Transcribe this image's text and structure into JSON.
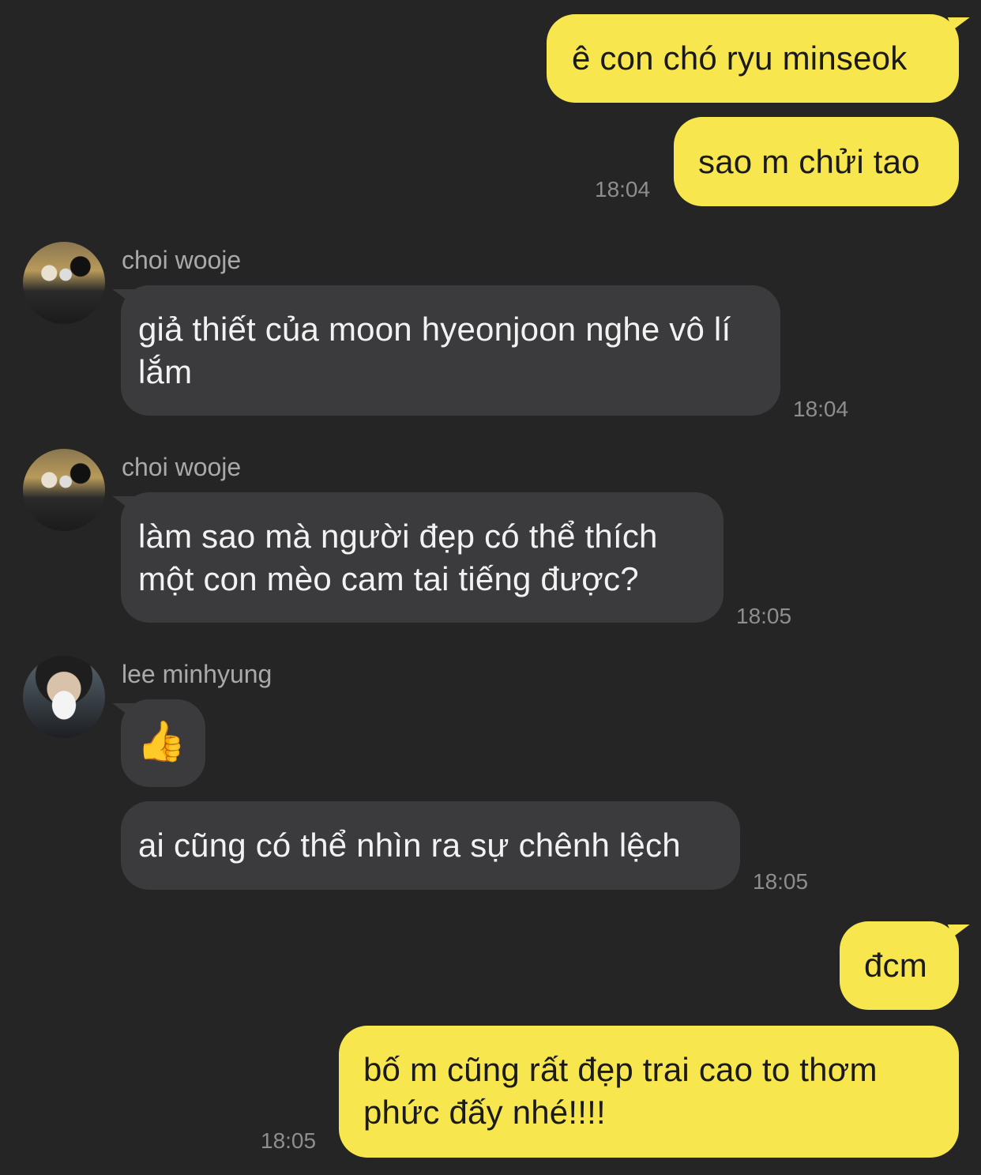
{
  "messages": [
    {
      "text": "ê con chó ryu minseok"
    },
    {
      "text": "sao m chửi tao",
      "time": "18:04"
    },
    {
      "sender": "choi wooje",
      "text": "giả thiết của moon hyeonjoon nghe vô lí lắm",
      "time": "18:04"
    },
    {
      "sender": "choi wooje",
      "text": "làm sao mà người đẹp có thể thích một con mèo cam tai tiếng được?",
      "time": "18:05"
    },
    {
      "sender": "lee minhyung",
      "emoji": "👍"
    },
    {
      "text": "ai cũng có thể nhìn ra sự chênh lệch",
      "time": "18:05"
    },
    {
      "text": "đcm"
    },
    {
      "text": "bố m cũng rất đẹp trai cao to thơm phức đấy nhé!!!!",
      "time": "18:05"
    }
  ],
  "colors": {
    "background": "#252525",
    "outgoing_bubble": "#F7E64D",
    "incoming_bubble": "#3B3B3D",
    "timestamp": "#8E8E8E"
  },
  "icons": {
    "thumbs_up": "thumbs-up-emoji"
  }
}
